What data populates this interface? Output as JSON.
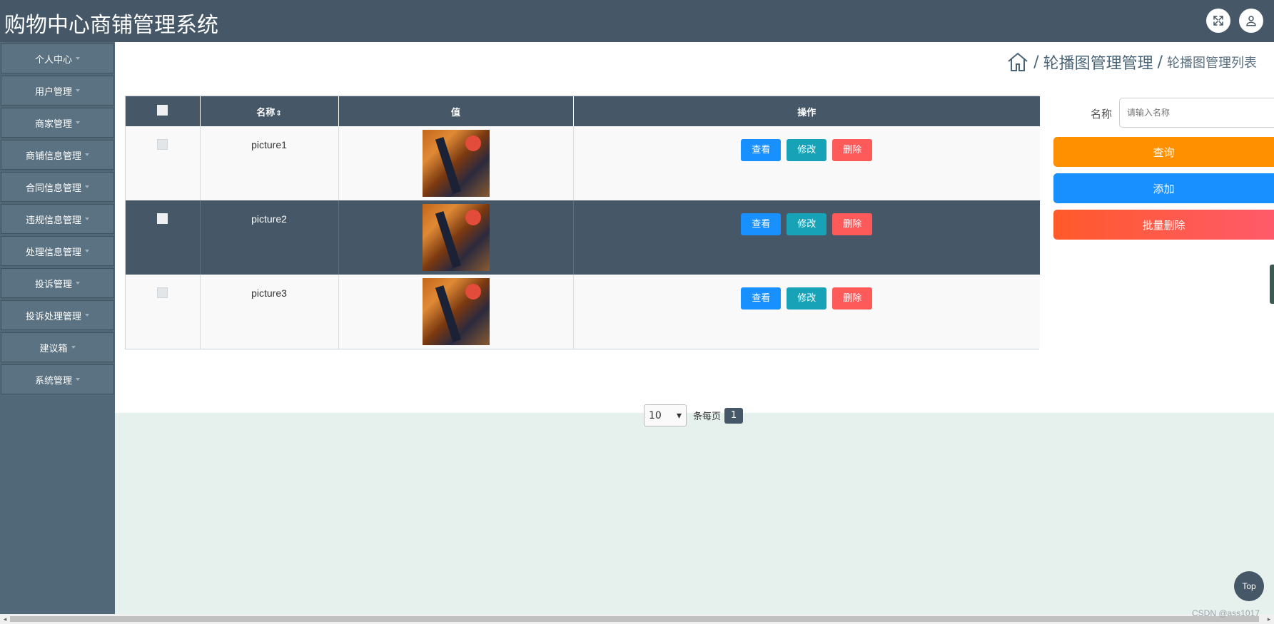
{
  "header": {
    "title": "购物中心商铺管理系统",
    "icons": [
      "fullscreen-icon",
      "user-icon"
    ]
  },
  "sidebar": {
    "items": [
      {
        "label": "个人中心"
      },
      {
        "label": "用户管理"
      },
      {
        "label": "商家管理"
      },
      {
        "label": "商铺信息管理"
      },
      {
        "label": "合同信息管理"
      },
      {
        "label": "违规信息管理"
      },
      {
        "label": "处理信息管理"
      },
      {
        "label": "投诉管理"
      },
      {
        "label": "投诉处理管理"
      },
      {
        "label": "建议箱"
      },
      {
        "label": "系统管理"
      }
    ]
  },
  "breadcrumb": {
    "sep": "/",
    "level1": "轮播图管理管理",
    "level2": "轮播图管理列表"
  },
  "table": {
    "headers": {
      "name": "名称",
      "sort_glyph": "⇕",
      "value": "值",
      "actions": "操作"
    },
    "rows": [
      {
        "name": "picture1",
        "style": "light"
      },
      {
        "name": "picture2",
        "style": "dark"
      },
      {
        "name": "picture3",
        "style": "light"
      }
    ],
    "buttons": {
      "view": "查看",
      "edit": "修改",
      "delete": "删除"
    }
  },
  "pagination": {
    "page_size": "10",
    "per_page_label": "条每页",
    "current_page": "1"
  },
  "search": {
    "label": "名称",
    "placeholder": "请输入名称"
  },
  "actions": {
    "query": "查询",
    "add": "添加",
    "batch_delete": "批量删除"
  },
  "top_button": "Top",
  "watermark": "CSDN @ass1017",
  "colors": {
    "header_bg": "#465868",
    "sidebar_bg": "#506878",
    "query": "#ff9000",
    "add": "#1890ff",
    "batch_delete": "#ff5a4a",
    "view": "#1890ff",
    "edit": "#17a2b8",
    "delete": "#ff5a5a"
  }
}
